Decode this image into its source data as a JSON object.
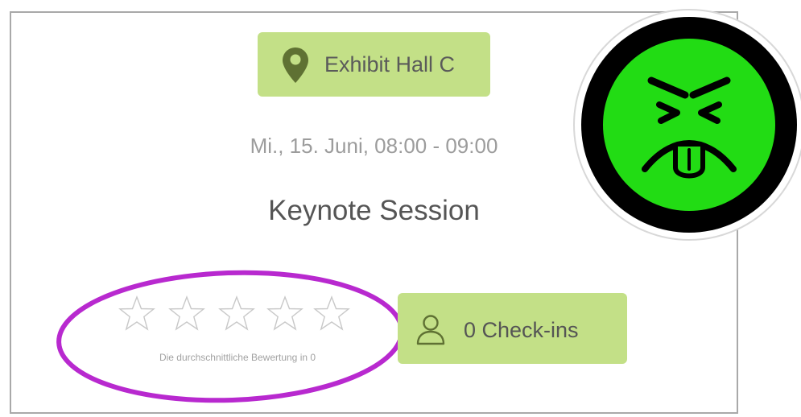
{
  "event": {
    "location": "Exhibit Hall C",
    "datetime": "Mi., 15. Juni, 08:00 - 09:00",
    "title": "Keynote Session"
  },
  "rating": {
    "caption": "Die durchschnittliche Bewertung in 0",
    "value": 0,
    "max": 5
  },
  "checkins": {
    "label": "0 Check-ins"
  },
  "icons": {
    "location": "map-pin-icon",
    "checkin": "person-icon",
    "star": "star-outline-icon",
    "logo": "mr-yuk-face-icon"
  },
  "colors": {
    "pill": "#c3e087",
    "pin": "#5f7133",
    "highlight": "#b829cf",
    "logo_face": "#22dc14"
  }
}
